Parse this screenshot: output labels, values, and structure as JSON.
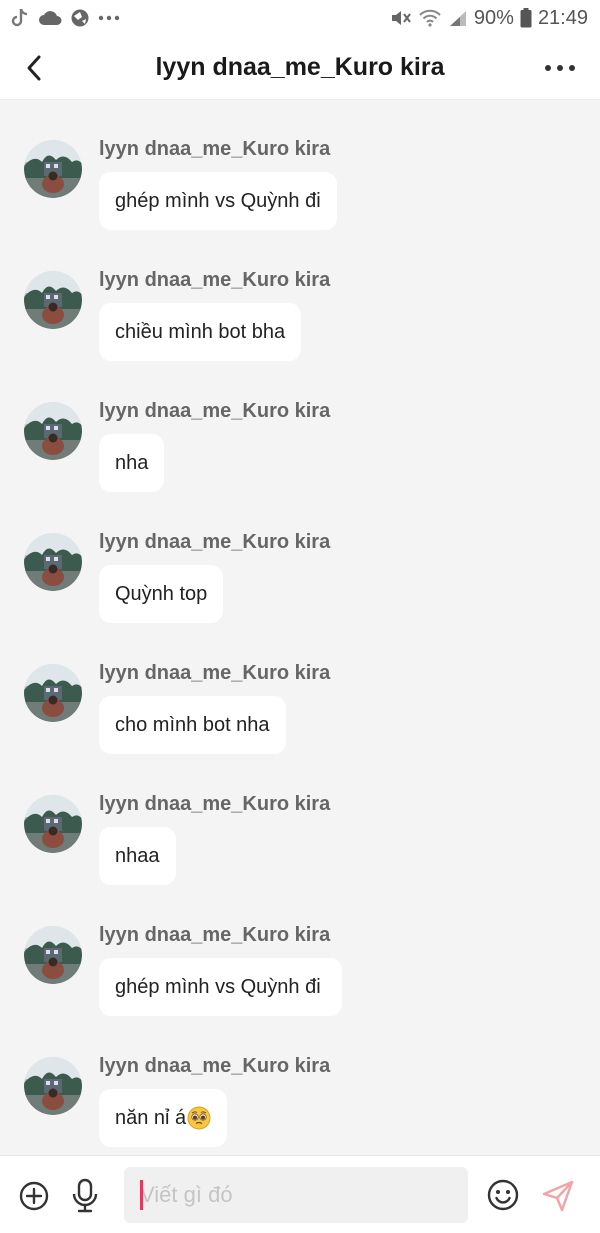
{
  "status_bar": {
    "battery": "90%",
    "time": "21:49",
    "icons": [
      "tiktok-icon",
      "cloud-icon",
      "vpn-icon",
      "more-dots-icon",
      "mute-icon",
      "wifi-icon",
      "signal-icon",
      "battery-icon"
    ]
  },
  "header": {
    "title": "lyyn dnaa_me_Kuro kira",
    "icons": [
      "back-icon",
      "more-icon"
    ]
  },
  "messages": [
    {
      "sender": "lyyn dnaa_me_Kuro kira",
      "text": "ghép mình vs Quỳnh đi"
    },
    {
      "sender": "lyyn dnaa_me_Kuro kira",
      "text": "chiều mình bot bha"
    },
    {
      "sender": "lyyn dnaa_me_Kuro kira",
      "text": "nha"
    },
    {
      "sender": "lyyn dnaa_me_Kuro kira",
      "text": "Quỳnh top"
    },
    {
      "sender": "lyyn dnaa_me_Kuro kira",
      "text": "cho mình bot nha"
    },
    {
      "sender": "lyyn dnaa_me_Kuro kira",
      "text": "nhaa"
    },
    {
      "sender": "lyyn dnaa_me_Kuro kira",
      "text": "ghép mình vs Quỳnh đi "
    },
    {
      "sender": "lyyn dnaa_me_Kuro kira",
      "text": "năn nỉ á",
      "emoji": "pleading-face-emoji"
    }
  ],
  "composer": {
    "placeholder": "Viết gì đó",
    "icons": [
      "plus-circle-icon",
      "microphone-icon",
      "smiley-icon",
      "send-icon"
    ]
  },
  "colors": {
    "background": "#f4f4f4",
    "bubble": "#ffffff",
    "accent": "#e8365d",
    "send_icon": "#f3a2a8"
  }
}
